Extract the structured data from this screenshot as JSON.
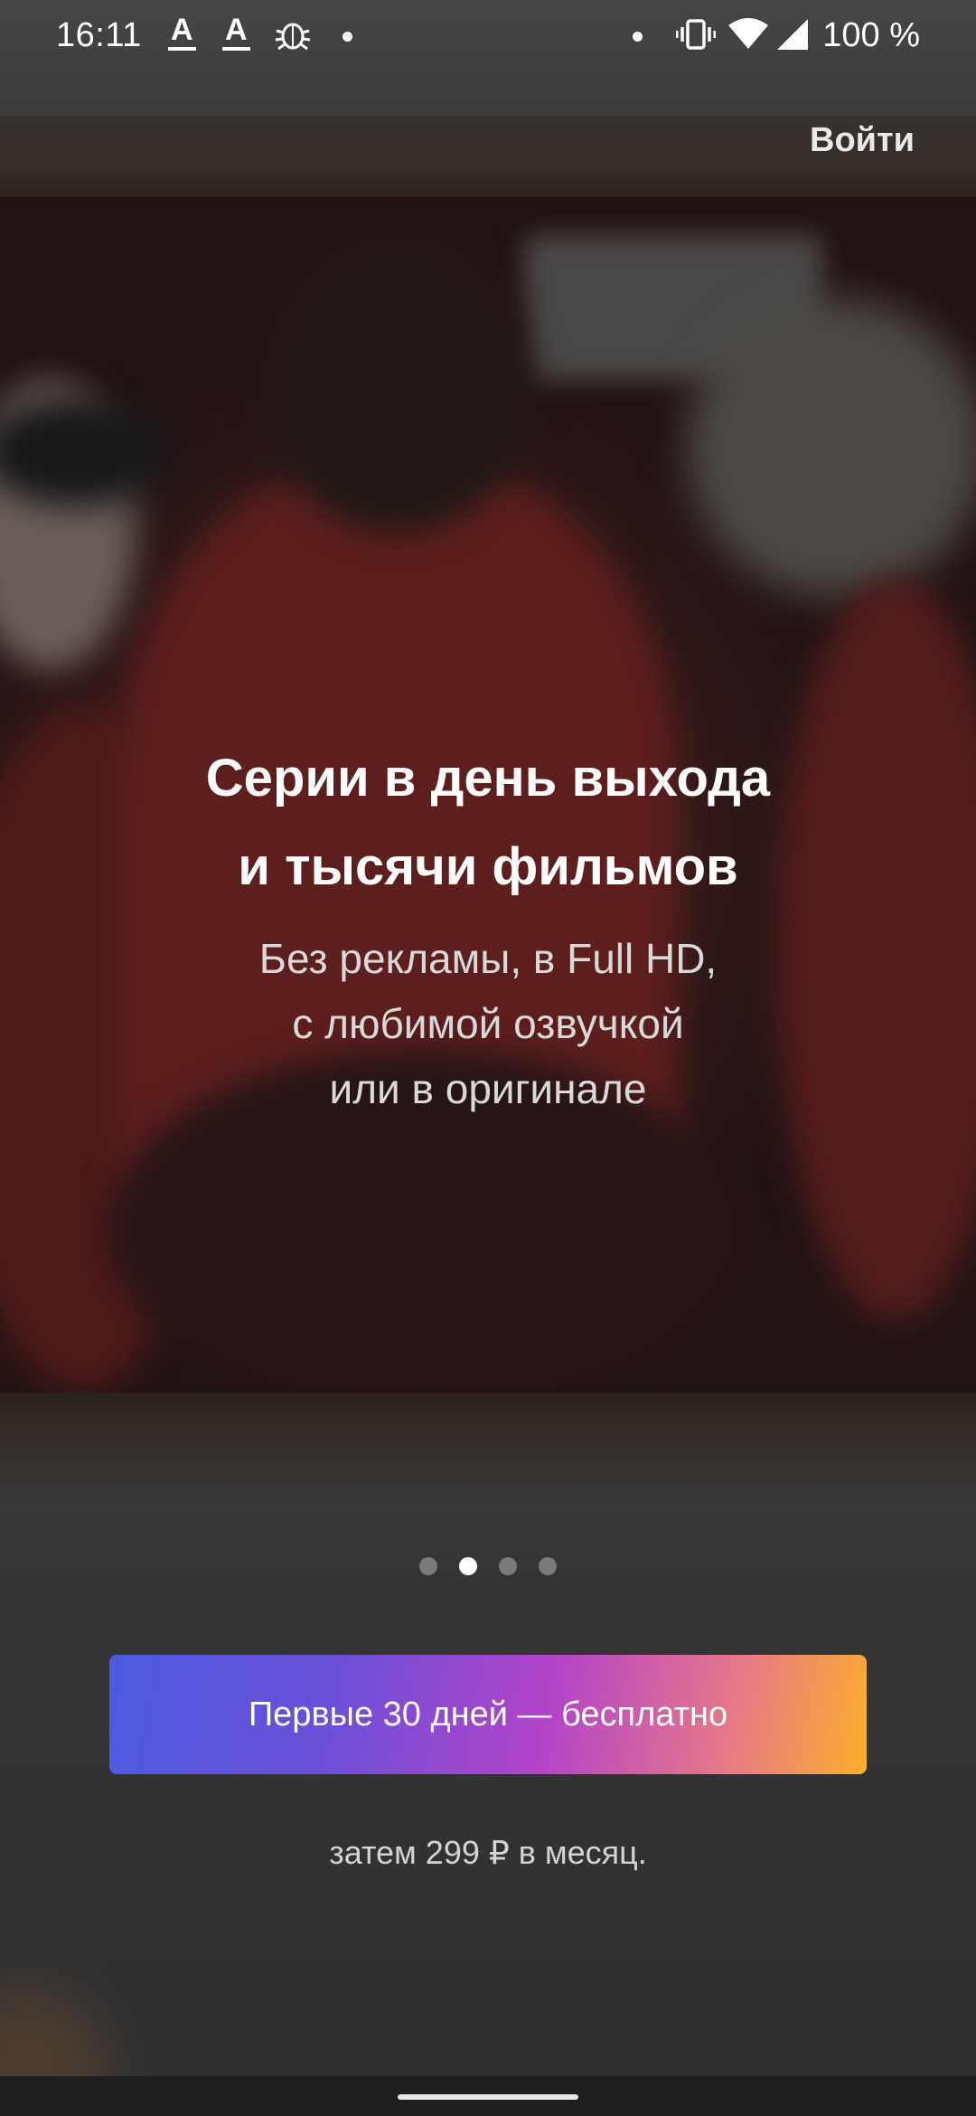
{
  "status_bar": {
    "time": "16:11",
    "notification_1": "A",
    "notification_2": "A",
    "battery": "100 %"
  },
  "header": {
    "login_label": "Войти"
  },
  "promo": {
    "headline_line1": "Серии в день выхода",
    "headline_line2": "и тысячи фильмов",
    "sub_line1": "Без рекламы, в Full HD,",
    "sub_line2": "с любимой озвучкой",
    "sub_line3": "или в оригинале"
  },
  "pager": {
    "count": 4,
    "active_index": 1
  },
  "cta": {
    "button_label": "Первые 30 дней — бесплатно",
    "price_note": "затем 299 ₽ в месяц.",
    "gradient_colors": [
      "#4b5be0",
      "#b444c8",
      "#fcae2c"
    ]
  },
  "icons": {
    "status": [
      "notification-a-icon",
      "notification-a-icon",
      "bug-icon",
      "dot-icon",
      "dot-icon",
      "vibrate-icon",
      "wifi-icon",
      "signal-icon"
    ]
  }
}
